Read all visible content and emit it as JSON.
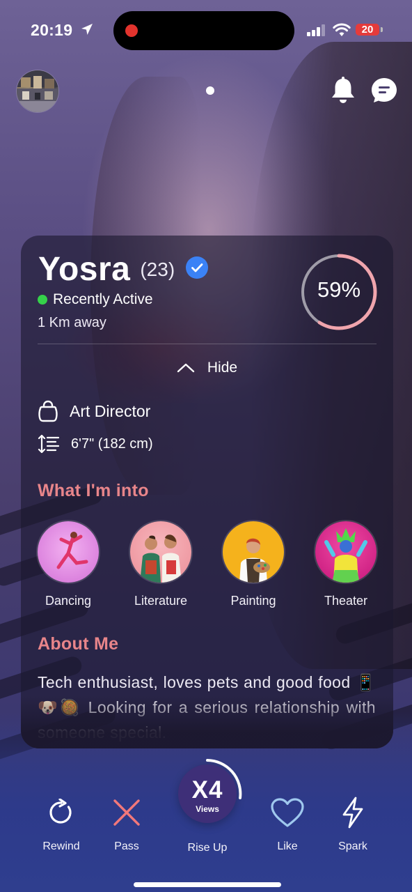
{
  "status_bar": {
    "time": "20:19",
    "battery": "20",
    "battery_color": "#e53b3b",
    "icons": [
      "location-arrow-icon",
      "cellular-signal-icon",
      "wifi-icon",
      "battery-icon"
    ]
  },
  "top_bar": {
    "icons": [
      "avatar",
      "notification-bell-icon",
      "chat-icon"
    ]
  },
  "profile": {
    "name": "Yosra",
    "age": "(23)",
    "activity": "Recently Active",
    "distance": "1 Km away",
    "match_percent": "59%",
    "match_fraction": 0.59,
    "hide_label": "Hide",
    "job": "Art Director",
    "height": "6'7\" (182 cm)"
  },
  "interests": {
    "title": "What I'm into",
    "items": [
      {
        "label": "Dancing",
        "color": "#e78be6"
      },
      {
        "label": "Literature",
        "color": "#f2a0a8"
      },
      {
        "label": "Painting",
        "color": "#f5b21c"
      },
      {
        "label": "Theater",
        "color": "#e82a8f"
      }
    ]
  },
  "about": {
    "title": "About Me",
    "text": "Tech enthusiast, loves pets and good food 📱🐶🥘 Looking for a serious relationship with someone special."
  },
  "bottom_bar": {
    "rewind": "Rewind",
    "pass": "Pass",
    "rise_multiplier": "X4",
    "rise_views": "Views",
    "rise_label": "Rise Up",
    "like": "Like",
    "spark": "Spark"
  },
  "colors": {
    "accent_section": "#e8858a",
    "active_green": "#35d14a",
    "verified_blue": "#3b82f6",
    "pass_red": "#f2787a",
    "like_blue": "#9fc8ee"
  }
}
